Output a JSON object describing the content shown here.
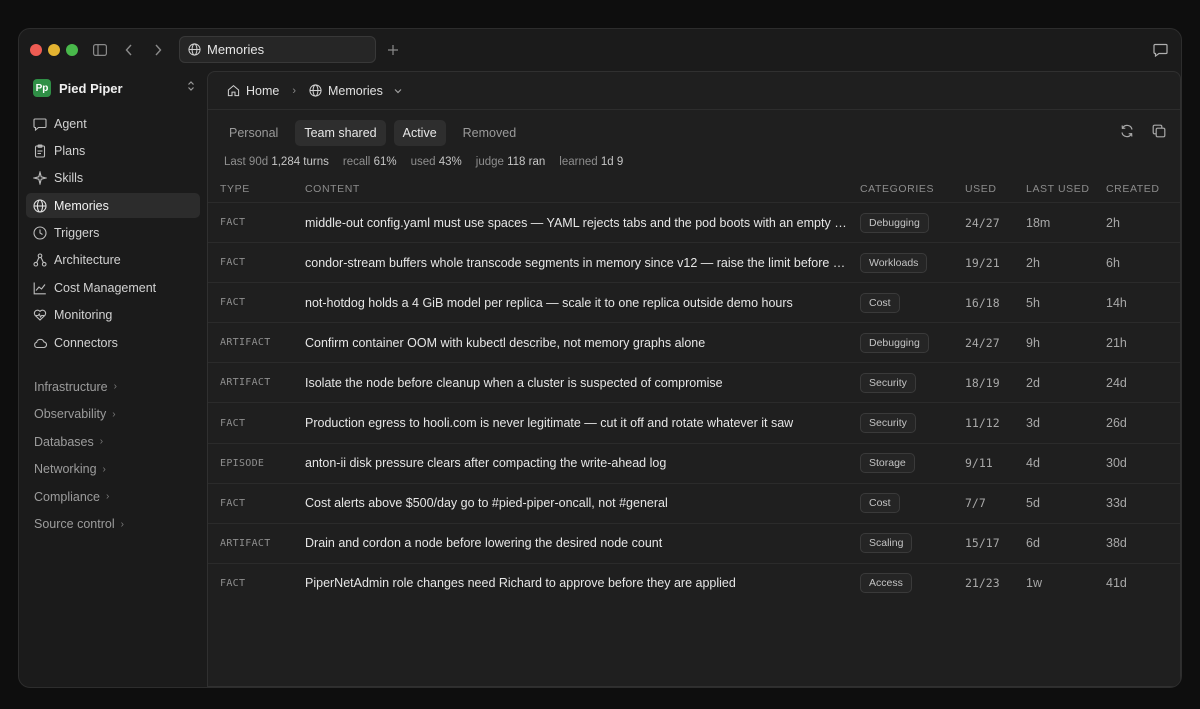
{
  "titlebar": {
    "tab_label": "Memories"
  },
  "workspace": {
    "logo_letters": "Pp",
    "name": "Pied Piper"
  },
  "sidebar": {
    "items": [
      {
        "label": "Agent",
        "icon": "chat-icon"
      },
      {
        "label": "Plans",
        "icon": "clipboard-icon"
      },
      {
        "label": "Skills",
        "icon": "sparkle-icon"
      },
      {
        "label": "Memories",
        "icon": "globe-icon",
        "active": true
      },
      {
        "label": "Triggers",
        "icon": "clock-icon"
      },
      {
        "label": "Architecture",
        "icon": "hierarchy-icon"
      },
      {
        "label": "Cost Management",
        "icon": "line-chart-icon"
      },
      {
        "label": "Monitoring",
        "icon": "heart-icon"
      },
      {
        "label": "Connectors",
        "icon": "cloud-icon"
      }
    ],
    "groups": [
      "Infrastructure",
      "Observability",
      "Databases",
      "Networking",
      "Compliance",
      "Source control"
    ]
  },
  "breadcrumb": {
    "home": "Home",
    "current": "Memories"
  },
  "filters": [
    "Personal",
    "Team shared",
    "Active",
    "Removed"
  ],
  "stats": [
    {
      "label": "Last 90d",
      "value": "1,284 turns"
    },
    {
      "label": "recall",
      "value": "61%"
    },
    {
      "label": "used",
      "value": "43%"
    },
    {
      "label": "judge",
      "value": "118 ran"
    },
    {
      "label": "learned",
      "value": "1d 9"
    }
  ],
  "table": {
    "headers": {
      "type": "TYPE",
      "content": "CONTENT",
      "categories": "CATEGORIES",
      "used": "USED",
      "last_used": "LAST USED",
      "created": "CREATED"
    },
    "rows": [
      {
        "type": "FACT",
        "content": "middle-out config.yaml must use spaces — YAML rejects tabs and the pod boots with an empty config",
        "category": "Debugging",
        "used": "24/27",
        "last_used": "18m",
        "created": "2h"
      },
      {
        "type": "FACT",
        "content": "condor-stream buffers whole transcode segments in memory since v12 — raise the limit before scaling",
        "category": "Workloads",
        "used": "19/21",
        "last_used": "2h",
        "created": "6h"
      },
      {
        "type": "FACT",
        "content": "not-hotdog holds a 4 GiB model per replica — scale it to one replica outside demo hours",
        "category": "Cost",
        "used": "16/18",
        "last_used": "5h",
        "created": "14h"
      },
      {
        "type": "ARTIFACT",
        "content": "Confirm container OOM with kubectl describe, not memory graphs alone",
        "category": "Debugging",
        "used": "24/27",
        "last_used": "9h",
        "created": "21h"
      },
      {
        "type": "ARTIFACT",
        "content": "Isolate the node before cleanup when a cluster is suspected of compromise",
        "category": "Security",
        "used": "18/19",
        "last_used": "2d",
        "created": "24d"
      },
      {
        "type": "FACT",
        "content": "Production egress to hooli.com is never legitimate — cut it off and rotate whatever it saw",
        "category": "Security",
        "used": "11/12",
        "last_used": "3d",
        "created": "26d"
      },
      {
        "type": "EPISODE",
        "content": "anton-ii disk pressure clears after compacting the write-ahead log",
        "category": "Storage",
        "used": "9/11",
        "last_used": "4d",
        "created": "30d"
      },
      {
        "type": "FACT",
        "content": "Cost alerts above $500/day go to #pied-piper-oncall, not #general",
        "category": "Cost",
        "used": "7/7",
        "last_used": "5d",
        "created": "33d"
      },
      {
        "type": "ARTIFACT",
        "content": "Drain and cordon a node before lowering the desired node count",
        "category": "Scaling",
        "used": "15/17",
        "last_used": "6d",
        "created": "38d"
      },
      {
        "type": "FACT",
        "content": "PiperNetAdmin role changes need Richard to approve before they are applied",
        "category": "Access",
        "used": "21/23",
        "last_used": "1w",
        "created": "41d"
      }
    ]
  }
}
